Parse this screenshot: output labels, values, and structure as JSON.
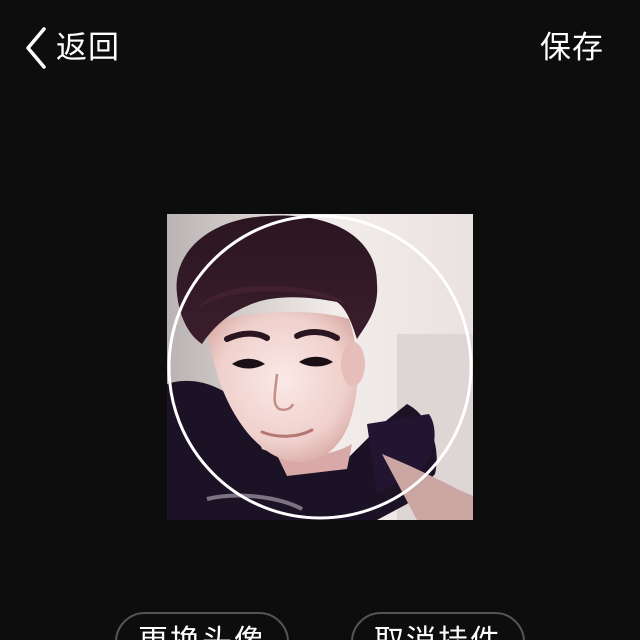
{
  "header": {
    "back_label": "返回",
    "save_label": "保存"
  },
  "icons": {
    "back": "chevron-left-icon"
  },
  "actions": {
    "change_avatar_label": "更换头像",
    "cancel_pendant_label": "取消挂件"
  },
  "colors": {
    "background": "#0d0d0d",
    "text": "#ffffff",
    "crop_ring": "#ffffff",
    "button_border": "#555555"
  }
}
